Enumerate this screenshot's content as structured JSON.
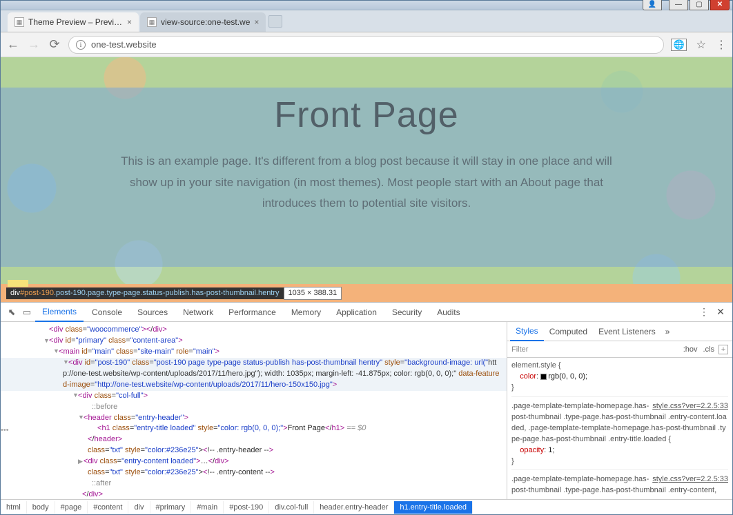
{
  "window": {
    "tabs": [
      {
        "title": "Theme Preview – Preview",
        "active": true
      },
      {
        "title": "view-source:one-test.we",
        "active": false
      }
    ],
    "nav": {
      "back_enabled": true,
      "forward_enabled": false
    },
    "omnibox_url": "one-test.website"
  },
  "page": {
    "title": "Front Page",
    "paragraph": "This is an example page. It's different from a blog post because it will stay in one place and will show up in your site navigation (in most themes). Most people start with an About page that introduces them to potential site visitors.",
    "inspect_tooltip": {
      "tag": "div",
      "id": "#post-190",
      "classes": ".post-190.page.type-page.status-publish.has-post-thumbnail.hentry",
      "dimensions": "1035 × 388.31"
    }
  },
  "devtools": {
    "main_tabs": [
      "Elements",
      "Console",
      "Sources",
      "Network",
      "Performance",
      "Memory",
      "Application",
      "Security",
      "Audits"
    ],
    "main_active": 0,
    "dom": {
      "l1": "<div class=\"woocommerce\"></div>",
      "l2a": "<div id=\"primary\" class=\"content-area\">",
      "l3a": "<main id=\"main\" class=\"site-main\" role=\"main\">",
      "l4a": "<div id=\"post-190\" class=\"post-190 page type-page status-publish has-post-thumbnail hentry\" style=\"background-image: url(\"http://one-test.website/wp-content/uploads/2017/11/hero.jpg\"); width: 1035px; margin-left: -41.875px; color: rgb(0, 0, 0);\" data-featured-image=\"http://one-test.website/wp-content/uploads/2017/11/hero-150x150.jpg\">",
      "l5a": "<div class=\"col-full\">",
      "l6": "::before",
      "l7a": "<header class=\"entry-header\">",
      "l8_open": "<h1 class=\"entry-title loaded\" style=\"color: rgb(0, 0, 0);\">",
      "l8_text": "Front Page",
      "l8_close": "</h1>",
      "l8_eq": " == $0",
      "l9": "</header>",
      "l10": "<!-- .entry-header -->",
      "l11": "<div class=\"entry-content loaded\">…</div>",
      "l12": "<!-- .entry-content -->",
      "l13": "::after",
      "l14": "</div>"
    },
    "breadcrumbs": [
      "html",
      "body",
      "#page",
      "#content",
      "div",
      "#primary",
      "#main",
      "#post-190",
      "div.col-full",
      "header.entry-header",
      "h1.entry-title.loaded"
    ],
    "breadcrumb_active_index": 10,
    "styles": {
      "tabs": [
        "Styles",
        "Computed",
        "Event Listeners"
      ],
      "tabs_active": 0,
      "filter_placeholder": "Filter",
      "hov": ":hov",
      "cls": ".cls",
      "rule1_selector": "element.style {",
      "rule1_prop": "color",
      "rule1_val": "rgb(0, 0, 0)",
      "rule1_close": "}",
      "rule2_link": "style.css?ver=2.2.5:33",
      "rule2_selector": ".page-template-template-homepage.has-post-thumbnail .type-page.has-post-thumbnail .entry-content.loaded, .page-template-template-homepage.has-post-thumbnail .type-page.has-post-thumbnail .entry-title.loaded {",
      "rule2_prop": "opacity",
      "rule2_val": "1",
      "rule2_close": "}",
      "rule3_link": "style.css?ver=2.2.5:33",
      "rule3_selector": ".page-template-template-homepage.has-post-thumbnail .type-page.has-post-thumbnail .entry-content,"
    }
  }
}
